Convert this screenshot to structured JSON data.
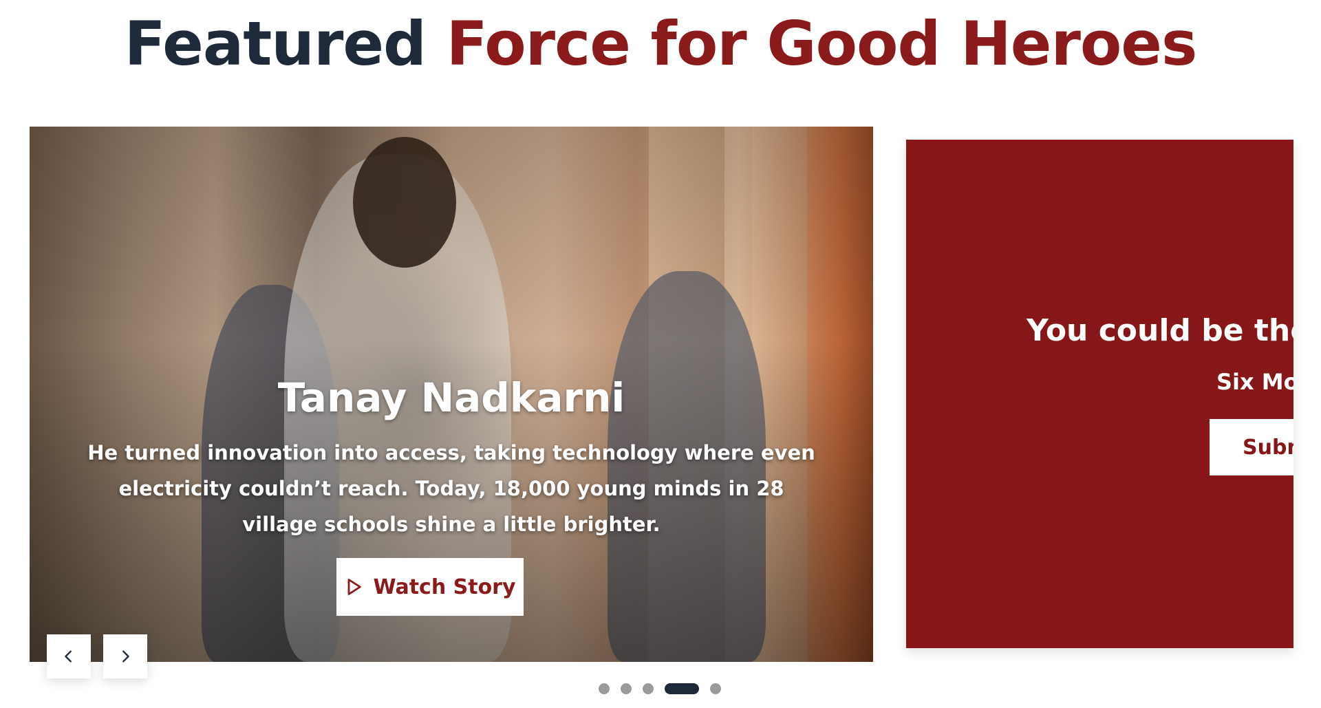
{
  "section": {
    "title_part1": "Featured",
    "title_part2": "Force for Good Heroes"
  },
  "slide": {
    "name": "Tanay Nadkarni",
    "description": "He turned innovation into access, taking technology where even electricity couldn’t reach. Today, 18,000 young minds in 28 village schools shine a little brighter.",
    "button_label": "Watch Story",
    "button_icon": "play-icon"
  },
  "carousel": {
    "prev_icon": "chevron-left-icon",
    "next_icon": "chevron-right-icon",
    "slide_count": 5,
    "active_index": 3
  },
  "cta": {
    "title": "You could be the ne",
    "subtitle": "Six Mor",
    "button_label": "Subm"
  },
  "colors": {
    "dark_navy": "#1e2a3a",
    "brand_red": "#8b1a1a",
    "panel_red": "#861617",
    "dot_inactive": "#9a9a9a"
  }
}
